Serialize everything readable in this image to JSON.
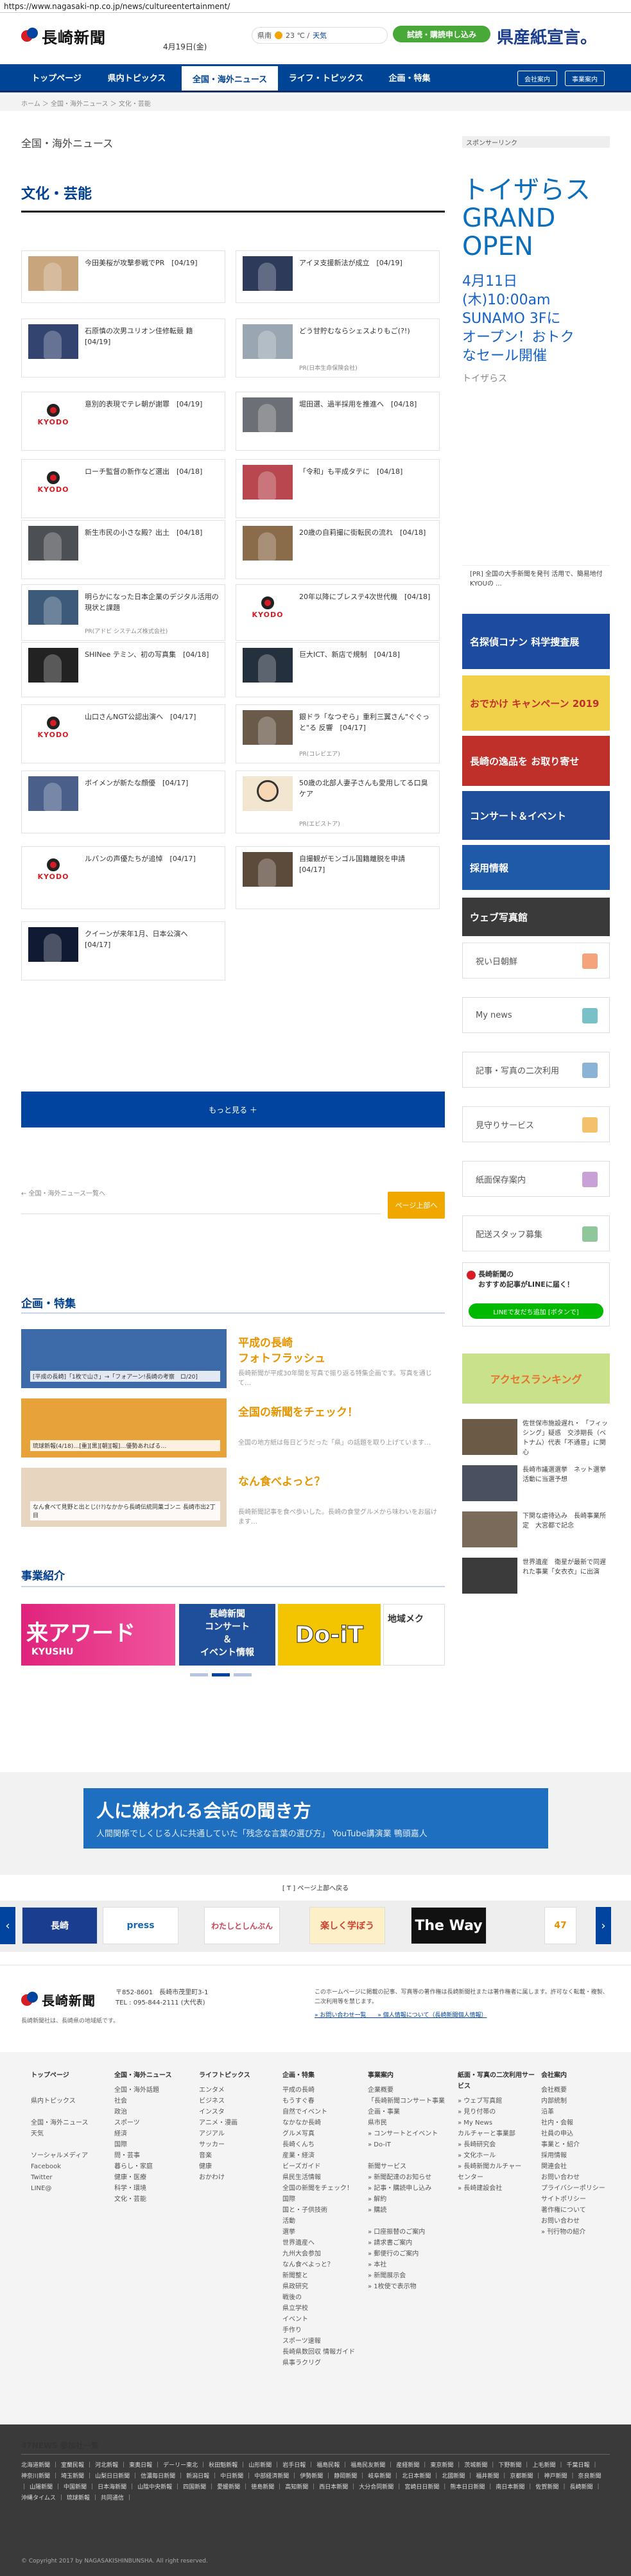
{
  "browser": {
    "url": "https://www.nagasaki-np.co.jp/news/cultureentertainment/"
  },
  "header": {
    "logo_text": "長崎新聞",
    "date": "4月19日(金)",
    "weather": {
      "place": "県南",
      "temp": "23 ℃ / ",
      "label": "天気"
    },
    "trial_button": "試読・購読申し込み",
    "banner_text": "県産紙宣言。"
  },
  "nav": {
    "items": [
      "トップページ",
      "県内トピックス",
      "全国・海外ニュース",
      "ライフ・トピックス",
      "企画・特集"
    ],
    "active_index": 2,
    "sub_buttons": [
      "会社案内",
      "事業案内"
    ]
  },
  "breadcrumb": "ホーム ＞ 全国・海外ニュース ＞ 文化・芸能",
  "section_title": "全国・海外ニュース",
  "category_title": "文化・芸能",
  "articles": [
    {
      "title": "今田美桜が攻撃参戦でPR　[04/19]",
      "thumb": "photo",
      "color": "#c9a57e",
      "sub": ""
    },
    {
      "title": "アイヌ支援新法が成立　[04/19]",
      "thumb": "photo",
      "color": "#2d3a5a",
      "sub": ""
    },
    {
      "title": "石原慎の次男ユリオン佳修転競 籍　[04/19]",
      "thumb": "photo",
      "color": "#334470",
      "sub": ""
    },
    {
      "title": "どう甘貯むならシェスよりもご(?!)",
      "thumb": "photo",
      "color": "#9aa7b3",
      "sub": "PR(日本生命保険会社)"
    },
    {
      "title": "意別的表現でテレ朝が謝罪　[04/19]",
      "thumb": "kyodo",
      "color": "",
      "sub": ""
    },
    {
      "title": "堀田選、過半採用を推進へ　[04/18]",
      "thumb": "photo",
      "color": "#6c6f75",
      "sub": ""
    },
    {
      "title": "ローチ監督の新作など選出　[04/18]",
      "thumb": "kyodo",
      "color": "",
      "sub": ""
    },
    {
      "title": "「令和」も平成タテに　[04/18]",
      "thumb": "photo",
      "color": "#b8474f",
      "sub": ""
    },
    {
      "title": "新生市民の小さな殿？出土　[04/18]",
      "thumb": "photo",
      "color": "#4c4f54",
      "sub": ""
    },
    {
      "title": "20歳の自莉撮に街転民の流れ　[04/18]",
      "thumb": "photo",
      "color": "#8a6b4a",
      "sub": ""
    },
    {
      "title": "明らかになった日本企業のデジタル活用の現状と課題",
      "thumb": "photo",
      "color": "#3d5a7a",
      "sub": "PR(アドビ システムズ株式会社)"
    },
    {
      "title": "20年以降にブレステ4次世代機　[04/18]",
      "thumb": "kyodo",
      "color": "",
      "sub": ""
    },
    {
      "title": "SHINee テミン、初の写真集　[04/18]",
      "thumb": "photo",
      "color": "#222",
      "sub": ""
    },
    {
      "title": "巨大ICT、新店で規制　[04/18]",
      "thumb": "photo",
      "color": "#25303f",
      "sub": ""
    },
    {
      "title": "山口さんNGT公認出演へ　[04/17]",
      "thumb": "kyodo",
      "color": "",
      "sub": ""
    },
    {
      "title": "銀ドラ「なつぞら」重利三翼さん\"ぐぐっと\"る 反響　[04/17]",
      "thumb": "photo",
      "color": "#6a5a4a",
      "sub": "PR(コレビエア)"
    },
    {
      "title": "ボイメンが新たな顔優　[04/17]",
      "thumb": "photo",
      "color": "#4a5f8a",
      "sub": ""
    },
    {
      "title": "50歳の北部人妻子さんも愛用してる口臭ケア",
      "thumb": "illus",
      "color": "#f2e6d0",
      "sub": "PR(エビストア)"
    },
    {
      "title": "ルパンの声優たちが追悼　[04/17]",
      "thumb": "kyodo",
      "color": "",
      "sub": ""
    },
    {
      "title": "自撮観がモンゴル国籍離脱を申請　[04/17]",
      "thumb": "photo",
      "color": "#5c4a3a",
      "sub": ""
    },
    {
      "title": "クイーンが来年1月、日本公演へ　[04/17]",
      "thumb": "photo",
      "color": "#111a33",
      "sub": ""
    }
  ],
  "more_button": "もっと見る ＋",
  "pager_prev": "← 全国・海外ニュース一覧へ",
  "back_to_top": "ページ上部へ",
  "features_title": "企画・特集",
  "features": [
    {
      "title": "平成の長崎\nフォトフラッシュ",
      "desc": "長崎新聞が平成30年間を写真で振り返る特集企画です。写真を通じて…",
      "caption": "[平成の長崎]「1枚で山さ」→「フォアーン!長崎の考察　ロ/20]",
      "color": "#3d6aa8"
    },
    {
      "title": "全国の新聞をチェック！",
      "desc": "全国の地方紙は毎日どうだった「県」の話題を取り上げています…",
      "caption": "琉球新報(4/18)…[重][黒][朝][報]…優勢あればる…",
      "color": "#e7a23a"
    },
    {
      "title": "なん食べよっと？",
      "desc": "長崎新聞記事を食べ歩いした。長崎の食堂グルメから味わいをお届けます…",
      "caption": "なん食べて見野と出とじ(!?)なかから長崎伝統同菓ゴンニ 長崎市出2丁目",
      "color": "#e8d5c0"
    }
  ],
  "business_title": "事業紹介",
  "promo": {
    "left": "来アワード",
    "sub": "KYUSHU",
    "mid": "長崎新聞\nコンサート\n＆\nイベント情報",
    "right": "Do-iT",
    "far": "地域メク"
  },
  "ad": {
    "title": "人に嫌われる会話の聞き方",
    "sub": "人間関係でしくじる人に共通していた「残念な言葉の選び方」 YouTube講演業 鴨頭嘉人"
  },
  "ad_caption": "[ T ] ページ上部へ戻る",
  "carousel": [
    "長崎",
    "press",
    "わたしとしんぶん",
    "楽しく学ぼう",
    "The Way",
    "47"
  ],
  "footer": {
    "logo": "長崎新聞",
    "address": "〒852-8601　長崎市茂里町3-1\nTEL : 095-844-2111 (大代表)",
    "note": "長崎新聞社は、長崎県の地域紙です。",
    "copyright_note": "このホームページに掲載の記事、写真等の著作権は長崎新聞社または著作権者に属します。許可なく転載・複製、二次利用等を禁じます。",
    "copyright_links": "» お問い合わせ一覧　　» 個人情報について（長崎新聞個人情報）",
    "cols": [
      {
        "head": "トップページ",
        "items": [
          "",
          "県内トピックス",
          "",
          "全国・海外ニュース",
          "天気",
          "",
          "ソーシャルメディア",
          "Facebook",
          "Twitter",
          "LINE@"
        ]
      },
      {
        "head": "全国・海外ニュース",
        "items": [
          "全国・海外話題",
          "社会",
          "政治",
          "スポーツ",
          "経済",
          "国際",
          "問・芸事",
          "暮らし・家庭",
          "健康・医療",
          "科学・環境",
          "文化・芸能"
        ]
      },
      {
        "head": "ライフトピックス",
        "items": [
          "エンタメ",
          "ビジネス",
          "インスタ",
          "アニメ・漫画",
          "アジアル",
          "サッカー",
          "音楽",
          "健康",
          "おかわけ"
        ]
      },
      {
        "head": "企画・特集",
        "items": [
          "平成の長崎",
          "もうすぐ春",
          "自然でイベント",
          "なかなか長崎",
          "グルメ写真",
          "長崎くんち",
          "産業・経済",
          "ビーズガイド",
          "県民生活情報",
          "全国の新聞をチェック！",
          "国際",
          "国と・子供技術",
          "活動",
          "選挙",
          "世界遺産へ",
          "九州大会参加",
          "なん食べよっと？",
          "新聞整と",
          "県政研究",
          "戦後の",
          "県立学校",
          "イベント",
          "手作り",
          "スポーツ速報",
          "長崎県数回収 情報ガイド",
          "県事ラクリグ"
        ]
      },
      {
        "head": "事業案内",
        "items": [
          "企業概要",
          "「長崎新聞コンサート事業」",
          "企画・事業",
          "県市民",
          "» コンサートとイベント",
          "» Do-iT",
          "",
          "新聞サービス",
          "» 新聞配達のお知らせ",
          "» 記事・購読申し込み",
          "» 解約",
          "» 購読",
          "",
          "» 口座振替のご案内",
          "» 請求書ご案内",
          "» 郵便行のご案内",
          "» 本社",
          "» 新聞展示会",
          "» 1枚使で表示物"
        ]
      },
      {
        "head": "紙面・写真の二次利用サービス",
        "items": [
          "» ウェブ写真館",
          "» 見り付帯の",
          "» My News",
          "カルチャーと事業部",
          "» 長崎研究会",
          "» 文化ホール",
          "» 長崎新聞カルチャー",
          "センター",
          "» 長崎建設会社"
        ]
      },
      {
        "head": "会社案内",
        "items": [
          "会社概要",
          "内部統制",
          "沿革",
          "社内・会報",
          "社員の申込",
          "事業と・紹介",
          "採用情報",
          "関連会社",
          "お問い合わせ",
          "プライバシーポリシー",
          "サイトポリシー",
          "著作権について",
          "お問い合わせ",
          "» 刊行物の紹介"
        ]
      }
    ],
    "news47_title": "47NEWS 参加社一覧",
    "news47": [
      "北海道新聞",
      "室蘭民報",
      "河北新報",
      "東奥日報",
      "デーリー東北",
      "秋田魁新報",
      "山形新聞",
      "岩手日報",
      "福島民報",
      "福島民友新聞",
      "産経新聞",
      "東京新聞",
      "茨城新聞",
      "下野新聞",
      "上毛新聞",
      "千葉日報",
      "神奈川新聞",
      "埼玉新聞",
      "山梨日日新聞",
      "信濃毎日新聞",
      "新潟日報",
      "中日新聞",
      "中部経済新聞",
      "伊勢新聞",
      "静岡新聞",
      "岐阜新聞",
      "北日本新聞",
      "北國新聞",
      "福井新聞",
      "京都新聞",
      "神戸新聞",
      "奈良新聞",
      "山陽新聞",
      "中国新聞",
      "日本海新聞",
      "山陰中央新報",
      "四国新聞",
      "愛媛新聞",
      "徳島新聞",
      "高知新聞",
      "西日本新聞",
      "大分合同新聞",
      "宮崎日日新聞",
      "熊本日日新聞",
      "南日本新聞",
      "佐賀新聞",
      "長崎新聞",
      "沖縄タイムス",
      "琉球新報",
      "共同通信"
    ],
    "copyright": "© Copyright 2017 by NAGASAKISHINBUNSHA. All right reserved."
  },
  "sidebar": {
    "head": "スポンサーリンク",
    "ad_title": "トイザらス\nGRAND\nOPEN",
    "ad_body": "4月11日\n(木)10:00am\nSUNAMO 3Fに\nオープン！おトク\nなセール開催",
    "ad_brand": "トイザらス",
    "ad_note": "[PR] 全国の大手新聞を発刊 活用で、簡易地付 KYOUの ...",
    "banners": [
      {
        "label": "名探偵コナン 科学捜査展",
        "color": "#1d4ba0"
      },
      {
        "label": "おでかけ キャンペーン 2019",
        "color": "#f1d04a"
      },
      {
        "label": "長崎の逸品を お取り寄せ",
        "color": "#c0302a"
      },
      {
        "label": "コンサート＆イベント",
        "color": "#1f4e9a"
      },
      {
        "label": "採用情報",
        "color": "#1e5aa8"
      },
      {
        "label": "ウェブ写真館",
        "color": "#3a3a3a"
      }
    ],
    "links": [
      {
        "label": "祝い日朝鮮",
        "color": "#f4a37a"
      },
      {
        "label": "My news",
        "color": "#7ac0c8"
      },
      {
        "label": "記事・写真の二次利用",
        "color": "#8ab3d6"
      },
      {
        "label": "見守りサービス",
        "color": "#f5c06b"
      },
      {
        "label": "紙面保存案内",
        "color": "#c8a2d6"
      },
      {
        "label": "配送スタッフ募集",
        "color": "#8fc79a"
      }
    ],
    "line_title": "長崎新聞の\nおすすめ記事がLINEに届く！",
    "line_button": "LINEで友だち追加 [ボタンで]",
    "ranking_banner": "アクセスランキング",
    "side_news": [
      {
        "text": "佐世保市施設遅れ・ 「フィッシング」疑惑　交渉期長（ベトナム）代表「不通意」に関心",
        "color": "#6a5a46"
      },
      {
        "text": "長崎市議選選挙　ネット選挙活動に当選予想",
        "color": "#4a5060"
      },
      {
        "text": "下関な虐待込み　長崎事業所定　大宮都で記念",
        "color": "#7a6a5a"
      },
      {
        "text": "世界遺産　衛星が最新で同遅れた事業「女衣衣」に出演",
        "color": "#3b3b3b"
      }
    ]
  }
}
